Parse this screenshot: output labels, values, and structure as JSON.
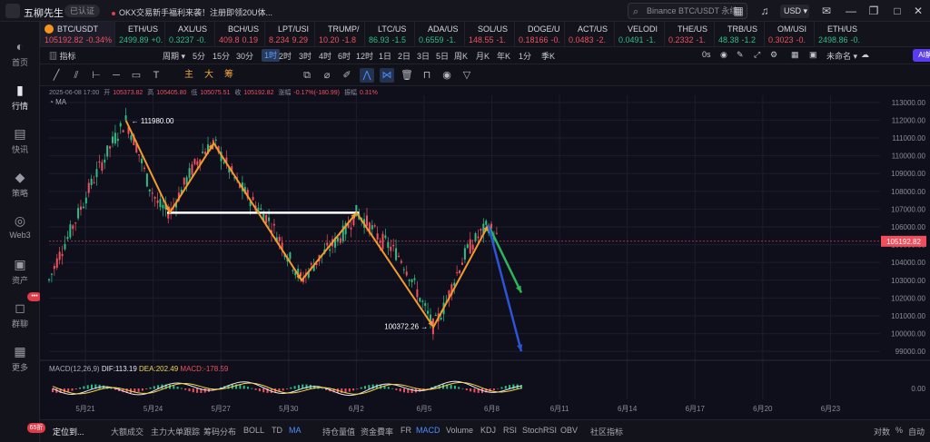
{
  "titlebar": {
    "app_name": "五柳先生",
    "verified_badge": "已认证",
    "news": "OKX交易新手福利来袭！注册即领20U体...",
    "search_placeholder": "Binance BTC/USDT 永续",
    "currency": "USD ▾"
  },
  "sidebar": {
    "items": [
      {
        "icon": "globe-icon",
        "label": "首页"
      },
      {
        "icon": "bar-chart-icon",
        "label": "行情"
      },
      {
        "icon": "news-icon",
        "label": "快讯"
      },
      {
        "icon": "strategy-icon",
        "label": "策略"
      },
      {
        "icon": "web3-icon",
        "label": "Web3"
      },
      {
        "icon": "wallet-icon",
        "label": "资产"
      },
      {
        "icon": "chat-icon",
        "label": "群聊"
      },
      {
        "icon": "more-icon",
        "label": "更多"
      }
    ],
    "chat_badge": "•••",
    "notif_badge": "65折"
  },
  "tickers": [
    {
      "sym": "BTC/USDT",
      "px": "105192.82",
      "chg": "-0.34%",
      "color": "#f0505f",
      "active": true
    },
    {
      "sym": "ETH/US",
      "px": "2499.89",
      "chg": "+0.",
      "color": "#2ebd85"
    },
    {
      "sym": "AXL/US",
      "px": "0.3237",
      "chg": "-0.",
      "color": "#2ebd85"
    },
    {
      "sym": "BCH/US",
      "px": "409.8",
      "chg": "0.19",
      "color": "#f0505f"
    },
    {
      "sym": "LPT/USI",
      "px": "8.234",
      "chg": "9.29",
      "color": "#f0505f"
    },
    {
      "sym": "TRUMP/",
      "px": "10.20",
      "chg": "-1.8",
      "color": "#f0505f"
    },
    {
      "sym": "LTC/US",
      "px": "86.93",
      "chg": "-1.5",
      "color": "#2ebd85"
    },
    {
      "sym": "ADA/US",
      "px": "0.6559",
      "chg": "-1.",
      "color": "#2ebd85"
    },
    {
      "sym": "SOL/US",
      "px": "148.55",
      "chg": "-1.",
      "color": "#f0505f"
    },
    {
      "sym": "DOGE/U",
      "px": "0.18166",
      "chg": "-0.",
      "color": "#f0505f"
    },
    {
      "sym": "ACT/US",
      "px": "0.0483",
      "chg": "-2.",
      "color": "#f0505f"
    },
    {
      "sym": "VELODI",
      "px": "0.0491",
      "chg": "-1.",
      "color": "#2ebd85"
    },
    {
      "sym": "THE/US",
      "px": "0.2332",
      "chg": "-1.",
      "color": "#f0505f"
    },
    {
      "sym": "TRB/US",
      "px": "48.38",
      "chg": "-1.2",
      "color": "#2ebd85"
    },
    {
      "sym": "OM/USI",
      "px": "0.3023",
      "chg": "-0.",
      "color": "#f0505f"
    },
    {
      "sym": "ETH/US",
      "px": "2498.86",
      "chg": "-0.",
      "color": "#2ebd85"
    }
  ],
  "toolbar1": {
    "indicators": "指标",
    "period": "周期 ▾",
    "timeframes": [
      "5分",
      "15分",
      "30分",
      "1时",
      "2时",
      "3时",
      "4时",
      "6时",
      "12时",
      "1日",
      "2日",
      "3日",
      "5日",
      "周K",
      "月K",
      "年K",
      "1分",
      "季K"
    ],
    "selected_timeframe": "1时",
    "countdown": "0s",
    "layout": "未命名 ▾",
    "ai": "AI解读"
  },
  "toolbar2": {
    "tools": [
      "trendline-icon",
      "parallel-icon",
      "ray-icon",
      "hline-icon",
      "rect-icon",
      "text-icon"
    ],
    "zh_tools": [
      "主",
      "大",
      "筹"
    ],
    "tools2": [
      "settings-icon",
      "lock-icon",
      "pen-icon",
      "zigzag-icon",
      "pattern-icon",
      "trash-icon",
      "magnet-icon",
      "eye-icon",
      "filter-icon"
    ]
  },
  "ohlc": {
    "datetime": "2025-06-08 17:00",
    "open_label": "开",
    "open": "105373.82",
    "high_label": "高",
    "high": "105405.80",
    "low_label": "低",
    "low": "105075.51",
    "close_label": "收",
    "close": "105192.82",
    "change_label": "涨幅",
    "change": "-0.17%(-180.99)",
    "amp_label": "振幅",
    "amp": "0.31%"
  },
  "ma_label": "MA",
  "macd": {
    "label": "MACD(12,26,9)",
    "dif": "DIF:113.19",
    "dea": "DEA:202.49",
    "macd": "MACD:-178.59",
    "zero": "0.00"
  },
  "chart_data": {
    "type": "line",
    "title": "BTC/USDT 1时",
    "y_axis": {
      "ticks": [
        113000,
        112000,
        111000,
        110000,
        109000,
        108000,
        107000,
        106000,
        105000,
        104000,
        103000,
        102000,
        101000,
        100000,
        99000
      ],
      "range": [
        98600,
        113400
      ]
    },
    "x_axis": {
      "ticks": [
        "5月21",
        "5月24",
        "5月27",
        "5月30",
        "6月2",
        "6月5",
        "6月8",
        "6月11",
        "6月14",
        "6月17",
        "6月20",
        "6月23"
      ]
    },
    "annotations": {
      "high": "111980.00",
      "low": "100372.26"
    },
    "price_path": [
      [
        0,
        103000
      ],
      [
        1,
        104500
      ],
      [
        2,
        105800
      ],
      [
        3,
        107200
      ],
      [
        4,
        108600
      ],
      [
        5,
        109800
      ],
      [
        6,
        111000
      ],
      [
        7,
        111980
      ],
      [
        8,
        110500
      ],
      [
        9,
        108500
      ],
      [
        10,
        107200
      ],
      [
        11,
        106800
      ],
      [
        12,
        108000
      ],
      [
        13,
        109200
      ],
      [
        14,
        110200
      ],
      [
        15,
        110700
      ],
      [
        16,
        109700
      ],
      [
        17,
        108600
      ],
      [
        18,
        107800
      ],
      [
        19,
        107100
      ],
      [
        20,
        106400
      ],
      [
        21,
        105300
      ],
      [
        22,
        104100
      ],
      [
        23,
        103000
      ],
      [
        24,
        103800
      ],
      [
        25,
        104500
      ],
      [
        26,
        105100
      ],
      [
        27,
        105800
      ],
      [
        28,
        106800
      ],
      [
        29,
        106200
      ],
      [
        30,
        105400
      ],
      [
        31,
        104900
      ],
      [
        32,
        104300
      ],
      [
        33,
        103100
      ],
      [
        34,
        101700
      ],
      [
        35,
        100372
      ],
      [
        36,
        101500
      ],
      [
        37,
        103200
      ],
      [
        38,
        104600
      ],
      [
        39,
        105400
      ],
      [
        40,
        106100
      ],
      [
        41,
        105192
      ]
    ],
    "zigzag": [
      [
        7,
        111980
      ],
      [
        11,
        106800
      ],
      [
        15,
        110700
      ],
      [
        23,
        103000
      ],
      [
        28,
        106800
      ],
      [
        35,
        100372
      ],
      [
        40,
        106100
      ]
    ],
    "support_line": {
      "from": [
        11,
        106800
      ],
      "to": [
        28,
        106800
      ]
    },
    "projection_green": {
      "from": [
        40,
        106100
      ],
      "to": [
        43,
        102300
      ]
    },
    "projection_blue": {
      "from": [
        40,
        106100
      ],
      "to": [
        43,
        99000
      ]
    },
    "current_price": 105192.82,
    "colors": {
      "up": "#2ebd85",
      "down": "#f0505f",
      "zigzag": "#f29a2e",
      "green_arrow": "#2db55d",
      "blue_arrow": "#2e53d9",
      "price_line": "#ef4f5d"
    }
  },
  "bottombar": {
    "items": [
      "定位到...",
      "大额成交",
      "主力大单跟踪",
      "筹码分布",
      "BOLL",
      "TD",
      "MA",
      "持仓量值",
      "资金費率",
      "FR",
      "MACD",
      "Volume",
      "KDJ",
      "RSI",
      "StochRSI",
      "OBV",
      "社区指标"
    ],
    "right": [
      "对数",
      "%",
      "自动"
    ]
  }
}
